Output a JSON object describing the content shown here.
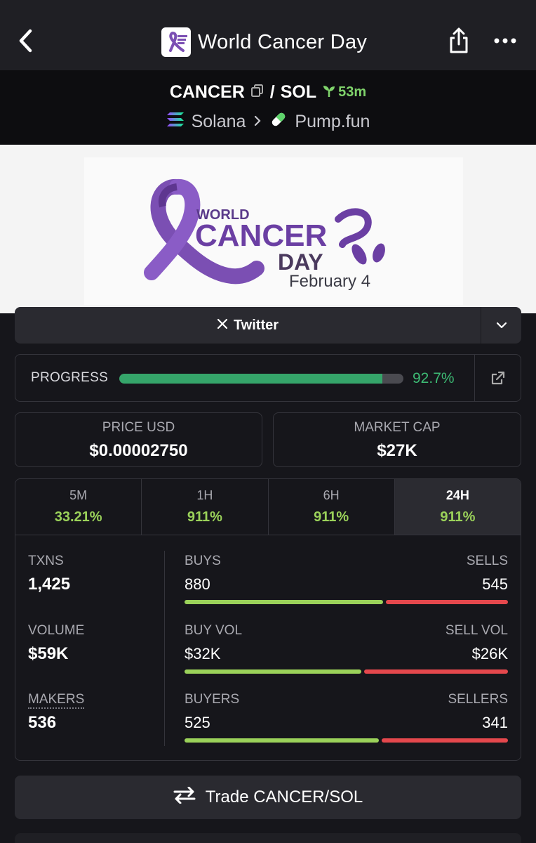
{
  "header": {
    "title": "World Cancer Day"
  },
  "pair": {
    "base": "CANCER",
    "separator": "/",
    "quote": "SOL",
    "age": "53m",
    "chain": "Solana",
    "dex": "Pump.fun"
  },
  "banner": {
    "line1": "WORLD",
    "line2": "CANCER",
    "line3": "DAY",
    "date": "February 4",
    "ribbon_color": "#7b4fb3"
  },
  "socials": {
    "twitter_label": "Twitter"
  },
  "progress": {
    "label": "PROGRESS",
    "value_text": "92.7%",
    "fraction": 0.927
  },
  "price": {
    "label": "PRICE USD",
    "value": "$0.00002750"
  },
  "market_cap": {
    "label": "MARKET CAP",
    "value": "$27K"
  },
  "timeframes": [
    {
      "label": "5M",
      "change": "33.21%"
    },
    {
      "label": "1H",
      "change": "911%"
    },
    {
      "label": "6H",
      "change": "911%"
    },
    {
      "label": "24H",
      "change": "911%",
      "active": true
    }
  ],
  "stats": {
    "txns": {
      "label": "TXNS",
      "value": "1,425"
    },
    "volume": {
      "label": "VOLUME",
      "value": "$59K"
    },
    "makers": {
      "label": "MAKERS",
      "value": "536"
    },
    "buys": {
      "label": "BUYS",
      "value": "880",
      "sell_label": "SELLS",
      "sell_value": "545",
      "buy_fraction": 0.618
    },
    "buy_vol": {
      "label": "BUY VOL",
      "value": "$32K",
      "sell_label": "SELL VOL",
      "sell_value": "$26K",
      "buy_fraction": 0.552
    },
    "buyers": {
      "label": "BUYERS",
      "value": "525",
      "sell_label": "SELLERS",
      "sell_value": "341",
      "buy_fraction": 0.606
    }
  },
  "trade": {
    "label": "Trade CANCER/SOL"
  },
  "colors": {
    "green": "#9bd25a",
    "red": "#e5484d",
    "progress_green": "#35a56a",
    "age_green": "#7fd36b"
  }
}
